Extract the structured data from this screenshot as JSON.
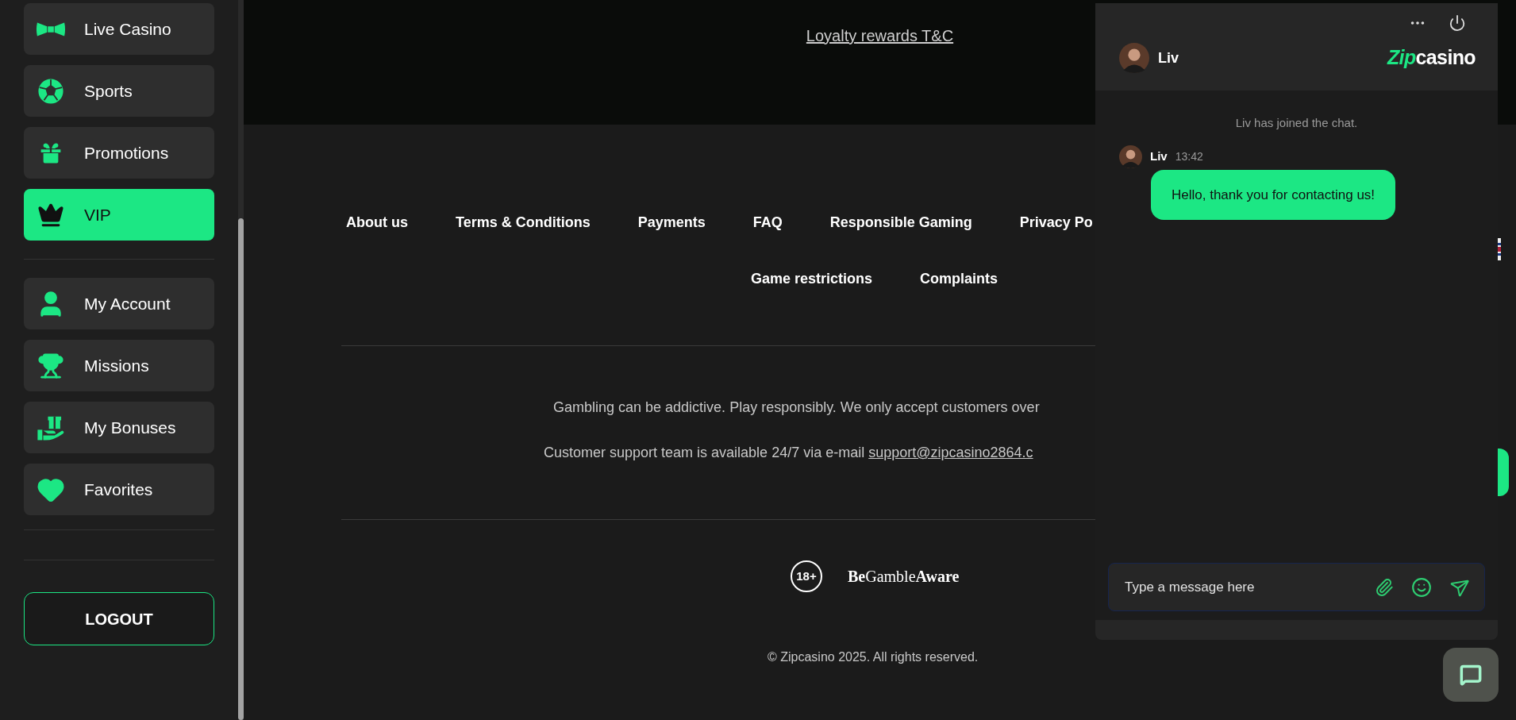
{
  "sidebar": {
    "groups": [
      {
        "items": [
          {
            "label": "Live Casino",
            "selected": false
          },
          {
            "label": "Sports",
            "selected": false
          },
          {
            "label": "Promotions",
            "selected": false
          },
          {
            "label": "VIP",
            "selected": true
          }
        ]
      },
      {
        "items": [
          {
            "label": "My Account",
            "selected": false
          },
          {
            "label": "Missions",
            "selected": false
          },
          {
            "label": "My Bonuses",
            "selected": false
          },
          {
            "label": "Favorites",
            "selected": false
          }
        ]
      }
    ],
    "logout": "LOGOUT"
  },
  "top_band": {
    "link": "Loyalty rewards T&C"
  },
  "footer": {
    "link_rows": [
      [
        "About us",
        "Terms & Conditions",
        "Payments",
        "FAQ",
        "Responsible Gaming",
        "Privacy Po"
      ],
      [
        "Game restrictions",
        "Complaints"
      ]
    ],
    "notice": "Gambling can be addictive. Play responsibly. We only accept customers over",
    "support_text": "Customer support team is available 24/7 via e-mail ",
    "support_email": "support@zipcasino2864.c",
    "age_badge": "18+",
    "gamble_aware": {
      "bold_start": "Be",
      "middle": "Gamble",
      "bold_end": "Aware"
    },
    "copyright": "© Zipcasino 2025. All rights reserved."
  },
  "chat": {
    "agent": "Liv",
    "logo": {
      "accent": "Zip",
      "rest": "casino"
    },
    "system_message": "Liv has joined the chat.",
    "messages": [
      {
        "author": "Liv",
        "time": "13:42",
        "text": "Hello, thank you for contacting us!"
      }
    ],
    "input": {
      "placeholder": "Type a message here"
    }
  }
}
